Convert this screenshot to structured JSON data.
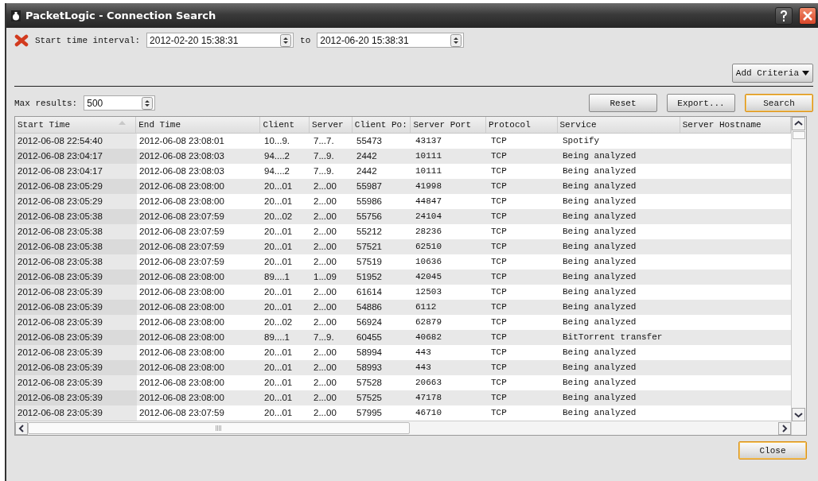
{
  "window": {
    "title": "PacketLogic - Connection Search"
  },
  "criteria": {
    "label": "Start time interval:",
    "from": "2012-02-20 15:38:31",
    "joiner": "to",
    "to": "2012-06-20 15:38:31"
  },
  "add_criteria": "Add Criteria",
  "max_results": {
    "label": "Max results:",
    "value": "500"
  },
  "buttons": [
    {
      "label": "Reset",
      "default": false
    },
    {
      "label": "Export...",
      "default": false
    },
    {
      "label": "Search",
      "default": true
    }
  ],
  "table": {
    "columns": [
      {
        "label": "Start Time",
        "sorted": true
      },
      {
        "label": "End Time",
        "sorted": false
      },
      {
        "label": "Client",
        "sorted": false
      },
      {
        "label": "Server",
        "sorted": false
      },
      {
        "label": "Client Po:",
        "sorted": false
      },
      {
        "label": "Server Port",
        "sorted": false
      },
      {
        "label": "Protocol",
        "sorted": false
      },
      {
        "label": "Service",
        "sorted": false
      },
      {
        "label": "Server Hostname",
        "sorted": false
      }
    ],
    "rows": [
      [
        "2012-06-08 22:54:40",
        "2012-06-08 23:08:01",
        "10...9.",
        "7...7.",
        "55473",
        "43137",
        "TCP",
        "Spotify"
      ],
      [
        "2012-06-08 23:04:17",
        "2012-06-08 23:08:03",
        "94....2",
        "7...9.",
        "2442",
        "10111",
        "TCP",
        "Being analyzed"
      ],
      [
        "2012-06-08 23:04:17",
        "2012-06-08 23:08:03",
        "94....2",
        "7...9.",
        "2442",
        "10111",
        "TCP",
        "Being analyzed"
      ],
      [
        "2012-06-08 23:05:29",
        "2012-06-08 23:08:00",
        "20...01",
        "2...00",
        "55987",
        "41998",
        "TCP",
        "Being analyzed"
      ],
      [
        "2012-06-08 23:05:29",
        "2012-06-08 23:08:00",
        "20...01",
        "2...00",
        "55986",
        "44847",
        "TCP",
        "Being analyzed"
      ],
      [
        "2012-06-08 23:05:38",
        "2012-06-08 23:07:59",
        "20...02",
        "2...00",
        "55756",
        "24104",
        "TCP",
        "Being analyzed"
      ],
      [
        "2012-06-08 23:05:38",
        "2012-06-08 23:07:59",
        "20...01",
        "2...00",
        "55212",
        "28236",
        "TCP",
        "Being analyzed"
      ],
      [
        "2012-06-08 23:05:38",
        "2012-06-08 23:07:59",
        "20...01",
        "2...00",
        "57521",
        "62510",
        "TCP",
        "Being analyzed"
      ],
      [
        "2012-06-08 23:05:38",
        "2012-06-08 23:07:59",
        "20...01",
        "2...00",
        "57519",
        "10636",
        "TCP",
        "Being analyzed"
      ],
      [
        "2012-06-08 23:05:39",
        "2012-06-08 23:08:00",
        "89....1",
        "1...09",
        "51952",
        "42045",
        "TCP",
        "Being analyzed"
      ],
      [
        "2012-06-08 23:05:39",
        "2012-06-08 23:08:00",
        "20...01",
        "2...00",
        "61614",
        "12503",
        "TCP",
        "Being analyzed"
      ],
      [
        "2012-06-08 23:05:39",
        "2012-06-08 23:08:00",
        "20...01",
        "2...00",
        "54886",
        "6112",
        "TCP",
        "Being analyzed"
      ],
      [
        "2012-06-08 23:05:39",
        "2012-06-08 23:08:00",
        "20...02",
        "2...00",
        "56924",
        "62879",
        "TCP",
        "Being analyzed"
      ],
      [
        "2012-06-08 23:05:39",
        "2012-06-08 23:08:00",
        "89....1",
        "7...9.",
        "60455",
        "40682",
        "TCP",
        "BitTorrent transfer"
      ],
      [
        "2012-06-08 23:05:39",
        "2012-06-08 23:08:00",
        "20...01",
        "2...00",
        "58994",
        "443",
        "TCP",
        "Being analyzed"
      ],
      [
        "2012-06-08 23:05:39",
        "2012-06-08 23:08:00",
        "20...01",
        "2...00",
        "58993",
        "443",
        "TCP",
        "Being analyzed"
      ],
      [
        "2012-06-08 23:05:39",
        "2012-06-08 23:08:00",
        "20...01",
        "2...00",
        "57528",
        "20663",
        "TCP",
        "Being analyzed"
      ],
      [
        "2012-06-08 23:05:39",
        "2012-06-08 23:08:00",
        "20...01",
        "2...00",
        "57525",
        "47178",
        "TCP",
        "Being analyzed"
      ],
      [
        "2012-06-08 23:05:39",
        "2012-06-08 23:07:59",
        "20...01",
        "2...00",
        "57995",
        "46710",
        "TCP",
        "Being analyzed"
      ]
    ]
  },
  "close": "Close"
}
